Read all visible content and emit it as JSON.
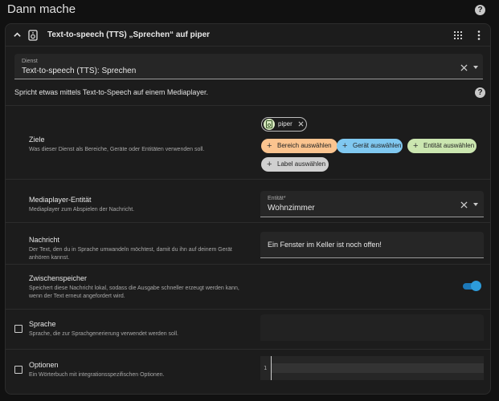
{
  "page": {
    "title": "Dann mache",
    "help_icon": "help-circle-icon"
  },
  "card": {
    "title": "Text-to-speech (TTS) „Sprechen“ auf piper",
    "icons": [
      "chevron-up-icon",
      "speaker-icon",
      "grid-icon",
      "more-vertical-icon"
    ]
  },
  "service": {
    "label": "Dienst",
    "value": "Text-to-speech (TTS): Sprechen"
  },
  "description": "Spricht etwas mittels Text-to-Speech auf einem Mediaplayer.",
  "targets": {
    "title": "Ziele",
    "subtitle": "Was dieser Dienst als Bereiche, Geräte oder Entitäten verwenden soll.",
    "selected_chip": "piper",
    "add_area": "Bereich auswählen",
    "add_device": "Gerät auswählen",
    "add_entity": "Entität auswählen",
    "add_label": "Label auswählen",
    "colors": {
      "area": "#fbc48f",
      "device": "#80c8f0",
      "entity": "#cbe6b0",
      "label": "#d0d0d0"
    }
  },
  "media_player": {
    "title": "Mediaplayer-Entität",
    "subtitle": "Mediaplayer zum Abspielen der Nachricht.",
    "label": "Entität*",
    "value": "Wohnzimmer"
  },
  "message": {
    "title": "Nachricht",
    "subtitle": "Der Text, den du in Sprache umwandeln möchtest, damit du ihn auf deinem Gerät anhören kannst.",
    "value": "Ein Fenster im Keller ist noch offen!"
  },
  "cache": {
    "title": "Zwischenspeicher",
    "subtitle": "Speichert diese Nachricht lokal, sodass die Ausgabe schneller erzeugt werden kann, wenn der Text erneut angefordert wird.",
    "enabled": true,
    "accent": "#2d9cdb"
  },
  "language": {
    "title": "Sprache",
    "subtitle": "Sprache, die zur Sprachgenerierung verwendet werden soll.",
    "checked": false
  },
  "options": {
    "title": "Optionen",
    "subtitle": "Ein Wörterbuch mit integrationsspezifischen Optionen.",
    "checked": false,
    "line_number": "1"
  }
}
